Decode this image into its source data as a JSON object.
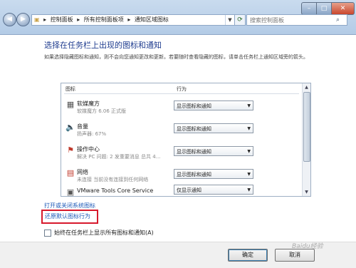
{
  "window": {
    "address": {
      "breadcrumbs": [
        "控制面板",
        "所有控制面板项",
        "通知区域图标"
      ]
    },
    "search": {
      "placeholder": "搜索控制面板"
    }
  },
  "main": {
    "title": "选择在任务栏上出现的图标和通知",
    "description": "如果选择隐藏图标和通知，则不会向您通知更改和更新。若要随时查看隐藏的图标，请单击任务栏上通知区域旁的箭头。",
    "table": {
      "col_icons": "图标",
      "col_behavior": "行为",
      "rows": [
        {
          "icon": "grid-app-icon",
          "name": "软媒魔方",
          "sub": "软媒魔方 6.06 正式版",
          "behavior": "显示图标和通知"
        },
        {
          "icon": "speaker-icon",
          "name": "音量",
          "sub": "扬声器: 67%",
          "behavior": "显示图标和通知"
        },
        {
          "icon": "flag-icon",
          "name": "操作中心",
          "sub": "解决 PC 问题: 2 发重要消息 总共 4...",
          "behavior": "显示图标和通知"
        },
        {
          "icon": "network-icon",
          "name": "网络",
          "sub": "未连接 当前没有连接到任何网络",
          "behavior": "显示图标和通知"
        },
        {
          "icon": "vmware-icon",
          "name": "VMware Tools Core Service",
          "sub": "",
          "behavior": "仅显示通知"
        }
      ]
    },
    "link_system_icons": "打开或关闭系统图标",
    "link_restore": "还原默认图标行为",
    "always_show_label": "始终在任务栏上显示所有图标和通知(A)"
  },
  "footer": {
    "ok_label": "确定",
    "cancel_label": "取消"
  },
  "watermark": "Baidu经验"
}
